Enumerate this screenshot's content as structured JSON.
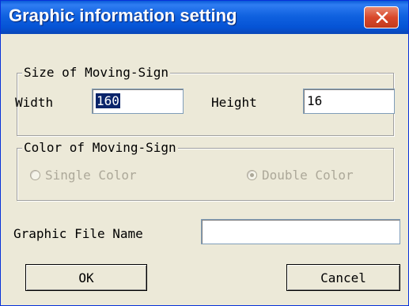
{
  "window": {
    "title": "Graphic information setting",
    "close_icon": "close-x-icon"
  },
  "size_group": {
    "legend": "Size of Moving-Sign",
    "width_label": "Width",
    "width_value": "160",
    "height_label": "Height",
    "height_value": "16"
  },
  "color_group": {
    "legend": "Color of Moving-Sign",
    "single_color_label": "Single Color",
    "double_color_label": "Double Color",
    "selected": "Double Color",
    "enabled": false
  },
  "file": {
    "label": "Graphic File Name",
    "value": ""
  },
  "buttons": {
    "ok_label": "OK",
    "cancel_label": "Cancel"
  },
  "colors": {
    "titlebar": "#0a5bd8",
    "close_button": "#d9482b",
    "dialog_face": "#ece9d8",
    "selection": "#0a246a",
    "disabled_text": "#aca899"
  }
}
